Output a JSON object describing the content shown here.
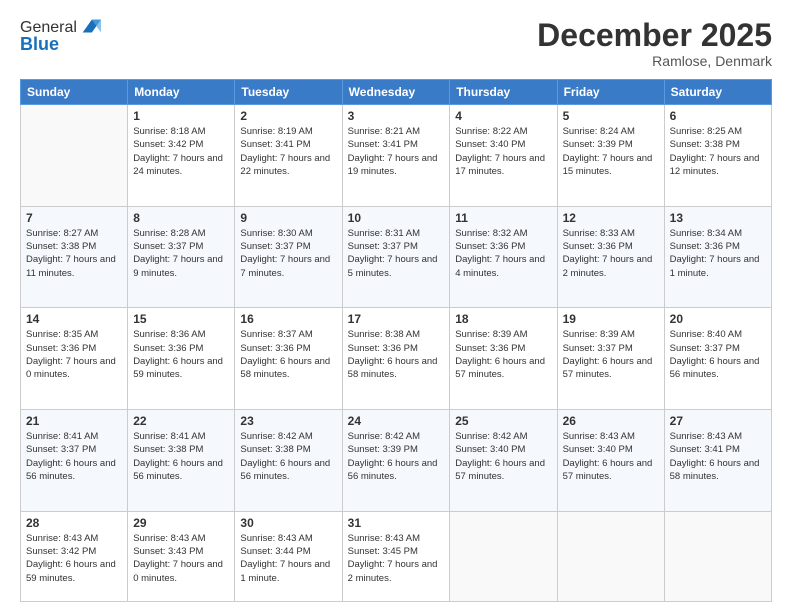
{
  "header": {
    "logo_general": "General",
    "logo_blue": "Blue",
    "month_title": "December 2025",
    "location": "Ramlose, Denmark"
  },
  "weekdays": [
    "Sunday",
    "Monday",
    "Tuesday",
    "Wednesday",
    "Thursday",
    "Friday",
    "Saturday"
  ],
  "weeks": [
    [
      {
        "day": "",
        "sunrise": "",
        "sunset": "",
        "daylight": ""
      },
      {
        "day": "1",
        "sunrise": "Sunrise: 8:18 AM",
        "sunset": "Sunset: 3:42 PM",
        "daylight": "Daylight: 7 hours and 24 minutes."
      },
      {
        "day": "2",
        "sunrise": "Sunrise: 8:19 AM",
        "sunset": "Sunset: 3:41 PM",
        "daylight": "Daylight: 7 hours and 22 minutes."
      },
      {
        "day": "3",
        "sunrise": "Sunrise: 8:21 AM",
        "sunset": "Sunset: 3:41 PM",
        "daylight": "Daylight: 7 hours and 19 minutes."
      },
      {
        "day": "4",
        "sunrise": "Sunrise: 8:22 AM",
        "sunset": "Sunset: 3:40 PM",
        "daylight": "Daylight: 7 hours and 17 minutes."
      },
      {
        "day": "5",
        "sunrise": "Sunrise: 8:24 AM",
        "sunset": "Sunset: 3:39 PM",
        "daylight": "Daylight: 7 hours and 15 minutes."
      },
      {
        "day": "6",
        "sunrise": "Sunrise: 8:25 AM",
        "sunset": "Sunset: 3:38 PM",
        "daylight": "Daylight: 7 hours and 12 minutes."
      }
    ],
    [
      {
        "day": "7",
        "sunrise": "Sunrise: 8:27 AM",
        "sunset": "Sunset: 3:38 PM",
        "daylight": "Daylight: 7 hours and 11 minutes."
      },
      {
        "day": "8",
        "sunrise": "Sunrise: 8:28 AM",
        "sunset": "Sunset: 3:37 PM",
        "daylight": "Daylight: 7 hours and 9 minutes."
      },
      {
        "day": "9",
        "sunrise": "Sunrise: 8:30 AM",
        "sunset": "Sunset: 3:37 PM",
        "daylight": "Daylight: 7 hours and 7 minutes."
      },
      {
        "day": "10",
        "sunrise": "Sunrise: 8:31 AM",
        "sunset": "Sunset: 3:37 PM",
        "daylight": "Daylight: 7 hours and 5 minutes."
      },
      {
        "day": "11",
        "sunrise": "Sunrise: 8:32 AM",
        "sunset": "Sunset: 3:36 PM",
        "daylight": "Daylight: 7 hours and 4 minutes."
      },
      {
        "day": "12",
        "sunrise": "Sunrise: 8:33 AM",
        "sunset": "Sunset: 3:36 PM",
        "daylight": "Daylight: 7 hours and 2 minutes."
      },
      {
        "day": "13",
        "sunrise": "Sunrise: 8:34 AM",
        "sunset": "Sunset: 3:36 PM",
        "daylight": "Daylight: 7 hours and 1 minute."
      }
    ],
    [
      {
        "day": "14",
        "sunrise": "Sunrise: 8:35 AM",
        "sunset": "Sunset: 3:36 PM",
        "daylight": "Daylight: 7 hours and 0 minutes."
      },
      {
        "day": "15",
        "sunrise": "Sunrise: 8:36 AM",
        "sunset": "Sunset: 3:36 PM",
        "daylight": "Daylight: 6 hours and 59 minutes."
      },
      {
        "day": "16",
        "sunrise": "Sunrise: 8:37 AM",
        "sunset": "Sunset: 3:36 PM",
        "daylight": "Daylight: 6 hours and 58 minutes."
      },
      {
        "day": "17",
        "sunrise": "Sunrise: 8:38 AM",
        "sunset": "Sunset: 3:36 PM",
        "daylight": "Daylight: 6 hours and 58 minutes."
      },
      {
        "day": "18",
        "sunrise": "Sunrise: 8:39 AM",
        "sunset": "Sunset: 3:36 PM",
        "daylight": "Daylight: 6 hours and 57 minutes."
      },
      {
        "day": "19",
        "sunrise": "Sunrise: 8:39 AM",
        "sunset": "Sunset: 3:37 PM",
        "daylight": "Daylight: 6 hours and 57 minutes."
      },
      {
        "day": "20",
        "sunrise": "Sunrise: 8:40 AM",
        "sunset": "Sunset: 3:37 PM",
        "daylight": "Daylight: 6 hours and 56 minutes."
      }
    ],
    [
      {
        "day": "21",
        "sunrise": "Sunrise: 8:41 AM",
        "sunset": "Sunset: 3:37 PM",
        "daylight": "Daylight: 6 hours and 56 minutes."
      },
      {
        "day": "22",
        "sunrise": "Sunrise: 8:41 AM",
        "sunset": "Sunset: 3:38 PM",
        "daylight": "Daylight: 6 hours and 56 minutes."
      },
      {
        "day": "23",
        "sunrise": "Sunrise: 8:42 AM",
        "sunset": "Sunset: 3:38 PM",
        "daylight": "Daylight: 6 hours and 56 minutes."
      },
      {
        "day": "24",
        "sunrise": "Sunrise: 8:42 AM",
        "sunset": "Sunset: 3:39 PM",
        "daylight": "Daylight: 6 hours and 56 minutes."
      },
      {
        "day": "25",
        "sunrise": "Sunrise: 8:42 AM",
        "sunset": "Sunset: 3:40 PM",
        "daylight": "Daylight: 6 hours and 57 minutes."
      },
      {
        "day": "26",
        "sunrise": "Sunrise: 8:43 AM",
        "sunset": "Sunset: 3:40 PM",
        "daylight": "Daylight: 6 hours and 57 minutes."
      },
      {
        "day": "27",
        "sunrise": "Sunrise: 8:43 AM",
        "sunset": "Sunset: 3:41 PM",
        "daylight": "Daylight: 6 hours and 58 minutes."
      }
    ],
    [
      {
        "day": "28",
        "sunrise": "Sunrise: 8:43 AM",
        "sunset": "Sunset: 3:42 PM",
        "daylight": "Daylight: 6 hours and 59 minutes."
      },
      {
        "day": "29",
        "sunrise": "Sunrise: 8:43 AM",
        "sunset": "Sunset: 3:43 PM",
        "daylight": "Daylight: 7 hours and 0 minutes."
      },
      {
        "day": "30",
        "sunrise": "Sunrise: 8:43 AM",
        "sunset": "Sunset: 3:44 PM",
        "daylight": "Daylight: 7 hours and 1 minute."
      },
      {
        "day": "31",
        "sunrise": "Sunrise: 8:43 AM",
        "sunset": "Sunset: 3:45 PM",
        "daylight": "Daylight: 7 hours and 2 minutes."
      },
      {
        "day": "",
        "sunrise": "",
        "sunset": "",
        "daylight": ""
      },
      {
        "day": "",
        "sunrise": "",
        "sunset": "",
        "daylight": ""
      },
      {
        "day": "",
        "sunrise": "",
        "sunset": "",
        "daylight": ""
      }
    ]
  ]
}
